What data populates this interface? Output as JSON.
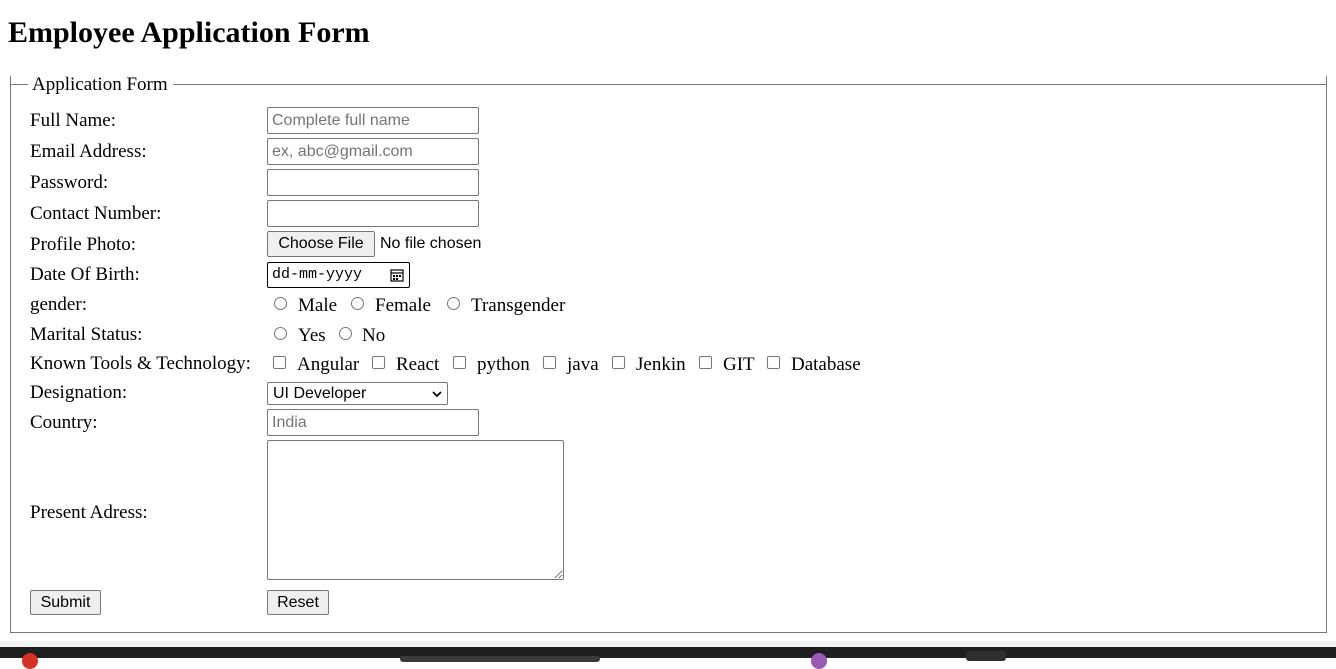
{
  "page": {
    "title": "Employee Application Form"
  },
  "form": {
    "legend": "Application Form",
    "full_name": {
      "label": "Full Name:",
      "placeholder": "Complete full name",
      "value": ""
    },
    "email": {
      "label": "Email Address:",
      "placeholder": "ex, abc@gmail.com",
      "value": ""
    },
    "password": {
      "label": "Password:",
      "value": ""
    },
    "contact": {
      "label": "Contact Number:",
      "value": ""
    },
    "photo": {
      "label": "Profile Photo:",
      "button": "Choose File",
      "status": "No file chosen"
    },
    "dob": {
      "label": "Date Of Birth:",
      "placeholder": "dd-mm-yyyy",
      "icon": "calendar-icon"
    },
    "gender": {
      "label": "gender:",
      "options": [
        "Male",
        "Female",
        "Transgender"
      ],
      "selected": null
    },
    "marital": {
      "label": "Marital Status:",
      "options": [
        "Yes",
        "No"
      ],
      "selected": null
    },
    "tools": {
      "label": "Known Tools & Technology:",
      "options": [
        "Angular",
        "React",
        "python",
        "java",
        "Jenkin",
        "GIT",
        "Database"
      ],
      "checked": []
    },
    "designation": {
      "label": "Designation:",
      "selected": "UI Developer",
      "icon": "chevron-down-icon"
    },
    "country": {
      "label": "Country:",
      "placeholder": "India",
      "value": ""
    },
    "address": {
      "label": "Present Adress:",
      "value": ""
    },
    "submit_label": "Submit",
    "reset_label": "Reset"
  },
  "colors": {
    "border": "#767676",
    "button_bg": "#efefef",
    "placeholder": "#757575",
    "taskbar": "#1f1f1f"
  }
}
